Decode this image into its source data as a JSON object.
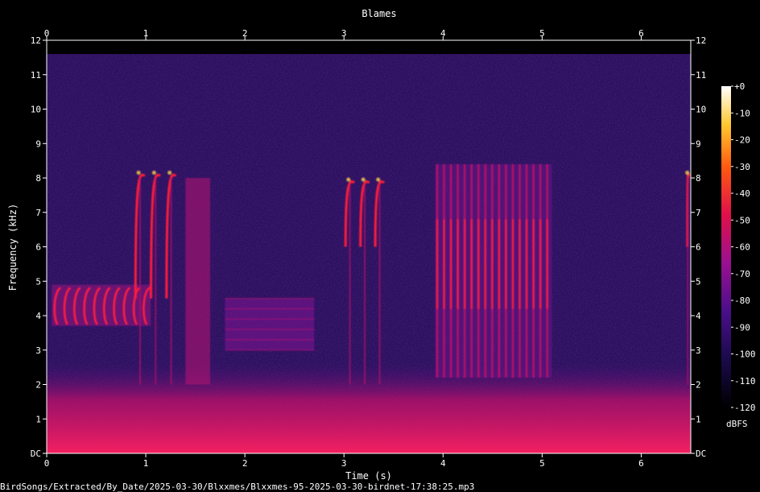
{
  "chart_data": {
    "type": "heatmap",
    "title": "Blames",
    "xlabel": "Time (s)",
    "ylabel": "Frequency (kHz)",
    "xlim": [
      0,
      6.5
    ],
    "ylim": [
      0,
      12
    ],
    "x_ticks": [
      "0",
      "1",
      "2",
      "3",
      "4",
      "5",
      "6"
    ],
    "y_ticks": [
      "DC",
      "1",
      "2",
      "3",
      "4",
      "5",
      "6",
      "7",
      "8",
      "9",
      "10",
      "11",
      "12"
    ],
    "colorbar": {
      "label": "dBFS",
      "range": [
        -120,
        0
      ],
      "ticks": [
        "+0",
        "-10",
        "-20",
        "-30",
        "-40",
        "-50",
        "-60",
        "-70",
        "-80",
        "-90",
        "-100",
        "-110",
        "-120"
      ]
    },
    "background_noise_khz": [
      0,
      11.6
    ],
    "strong_low_band_khz": [
      0,
      2
    ],
    "events": [
      {
        "kind": "trill",
        "t_start": 0.05,
        "t_end": 1.05,
        "f_low": 3.7,
        "f_high": 4.9,
        "notes": 10
      },
      {
        "kind": "downsweep",
        "t_start": 0.88,
        "t_end": 1.35,
        "f_low": 4.5,
        "f_high": 8.2,
        "notes": 3
      },
      {
        "kind": "broadband",
        "t_start": 1.4,
        "t_end": 1.65,
        "f_low": 2.0,
        "f_high": 8.0
      },
      {
        "kind": "buzz",
        "t_start": 1.8,
        "t_end": 2.7,
        "f_low": 3.0,
        "f_high": 4.5
      },
      {
        "kind": "downsweep",
        "t_start": 3.0,
        "t_end": 3.45,
        "f_low": 6.0,
        "f_high": 8.0,
        "notes": 3
      },
      {
        "kind": "pulse_train",
        "t_start": 3.92,
        "t_end": 5.1,
        "f_low": 2.2,
        "f_high": 8.4,
        "notes": 17
      },
      {
        "kind": "downsweep",
        "t_start": 6.45,
        "t_end": 6.5,
        "f_low": 6.0,
        "f_high": 8.2,
        "notes": 1
      }
    ]
  },
  "footer": {
    "path": "BirdSongs/Extracted/By_Date/2025-03-30/Blxxmes/Blxxmes-95-2025-03-30-birdnet-17:38:25.mp3"
  },
  "colors": {
    "background": "#000000",
    "noise": "#2a1060",
    "low_band": "#c0106a",
    "signal": "#ff1a3a",
    "peak": "#ffd24a"
  }
}
